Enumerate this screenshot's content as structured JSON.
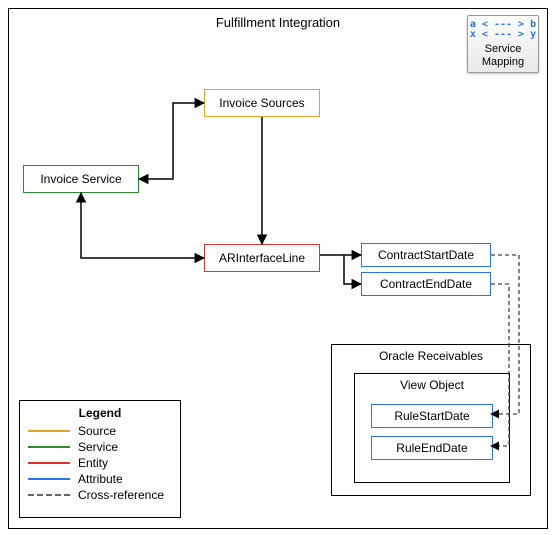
{
  "title": "Fulfillment Integration",
  "service_mapping": {
    "glyph_top": "a < --- > b",
    "glyph_bot": "x < --- > y",
    "line1": "Service",
    "line2": "Mapping"
  },
  "nodes": {
    "invoice_sources": "Invoice Sources",
    "invoice_service": "Invoice Service",
    "ar_interface_line": "ARInterfaceLine",
    "contract_start_date": "ContractStartDate",
    "contract_end_date": "ContractEndDate"
  },
  "oracle_receivables": {
    "title": "Oracle Receivables",
    "view_object": {
      "title": "View Object",
      "rule_start_date": "RuleStartDate",
      "rule_end_date": "RuleEndDate"
    }
  },
  "legend": {
    "title": "Legend",
    "items": {
      "source": "Source",
      "service": "Service",
      "entity": "Entity",
      "attribute": "Attribute",
      "cross_reference": "Cross-reference"
    }
  }
}
